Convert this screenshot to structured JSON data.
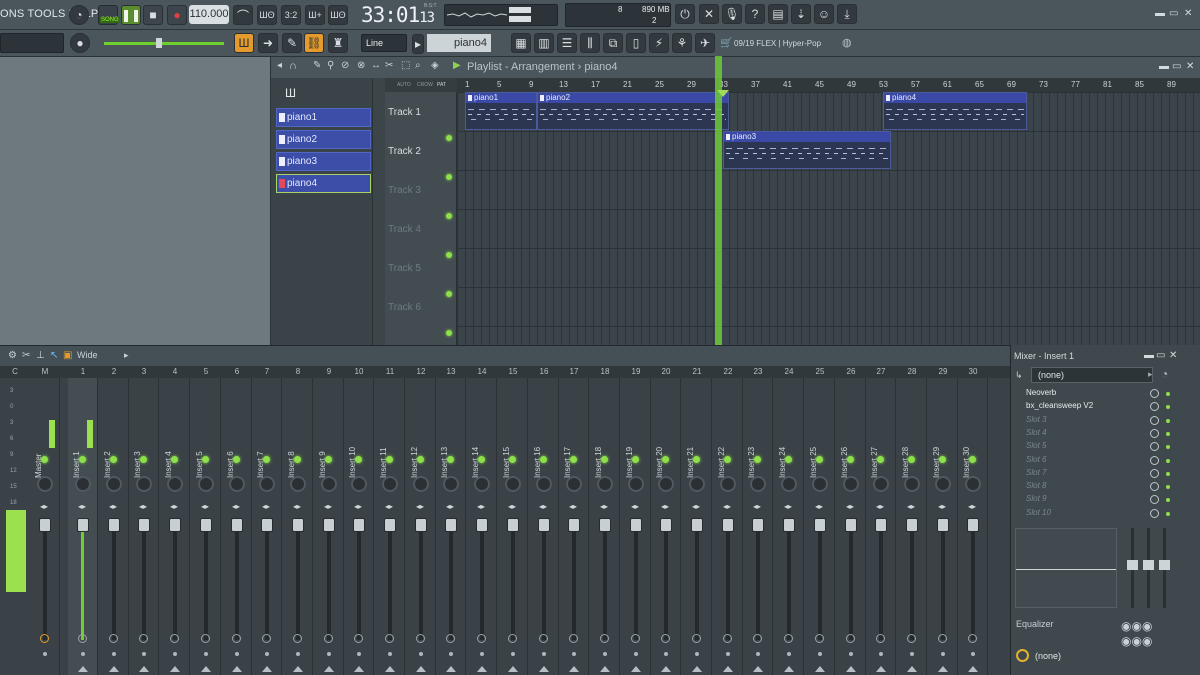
{
  "menu": {
    "left_text": "ONS TOOLS HELP"
  },
  "transport": {
    "song_label": "SONG",
    "tempo": "110.000",
    "time": "33:01",
    "time_sub": "13",
    "bst": "B:S:T",
    "cpu_value": "8",
    "memory": "890 MB",
    "voices": "2"
  },
  "toolbar2": {
    "snap_mode": "Line",
    "pattern_name": "piano4",
    "news_text": "09/19  FLEX | Hyper-Pop"
  },
  "playlist": {
    "title": "Playlist - Arrangement",
    "title_sep": "›",
    "title_pattern": "piano4",
    "patterns": [
      "piano1",
      "piano2",
      "piano3",
      "piano4"
    ],
    "tracks": [
      "Track 1",
      "Track 2",
      "Track 3",
      "Track 4",
      "Track 5",
      "Track 6"
    ],
    "ruler": [
      "1",
      "5",
      "9",
      "13",
      "17",
      "21",
      "25",
      "29",
      "33",
      "37",
      "41",
      "45",
      "49",
      "53",
      "57",
      "61",
      "65",
      "69",
      "73",
      "77",
      "81",
      "85",
      "89"
    ],
    "small_labels": [
      "AUTO",
      "CROW",
      "PAT"
    ],
    "clips": [
      {
        "name": "piano1"
      },
      {
        "name": "piano2"
      },
      {
        "name": "piano3"
      },
      {
        "name": "piano4"
      }
    ]
  },
  "mixer": {
    "mode": "Wide",
    "cm_labels": [
      "C",
      "M"
    ],
    "numbers": [
      "1",
      "2",
      "3",
      "4",
      "5",
      "6",
      "7",
      "8",
      "9",
      "10",
      "11",
      "12",
      "13",
      "14",
      "15",
      "16",
      "17",
      "18",
      "19",
      "20",
      "21",
      "22",
      "23",
      "24",
      "25",
      "26",
      "27",
      "28",
      "29",
      "30"
    ],
    "master_label": "Master",
    "strip_names": [
      "Insert 1",
      "Insert 2",
      "Insert 3",
      "Insert 4",
      "Insert 5",
      "Insert 6",
      "Insert 7",
      "Insert 8",
      "Insert 9",
      "Insert 10",
      "Insert 11",
      "Insert 12",
      "Insert 13",
      "Insert 14",
      "Insert 15",
      "Insert 16",
      "Insert 17",
      "Insert 18",
      "Insert 19",
      "Insert 20",
      "Insert 21",
      "Insert 22",
      "Insert 23",
      "Insert 24",
      "Insert 25",
      "Insert 26",
      "Insert 27",
      "Insert 28",
      "Insert 29",
      "Insert 30"
    ],
    "db_scale": [
      "3",
      "0",
      "3",
      "6",
      "9",
      "12",
      "15",
      "18"
    ]
  },
  "insert_panel": {
    "title": "Mixer - Insert 1",
    "input": "(none)",
    "slots": [
      "Neoverb",
      "bx_cleansweep V2",
      "Slot 3",
      "Slot 4",
      "Slot 5",
      "Slot 6",
      "Slot 7",
      "Slot 8",
      "Slot 9",
      "Slot 10"
    ],
    "eq_label": "Equalizer",
    "output": "(none)"
  },
  "colors": {
    "accent_green": "#8de04a",
    "pattern_blue": "#3d4ea8",
    "panel_gray": "#4a555c"
  }
}
